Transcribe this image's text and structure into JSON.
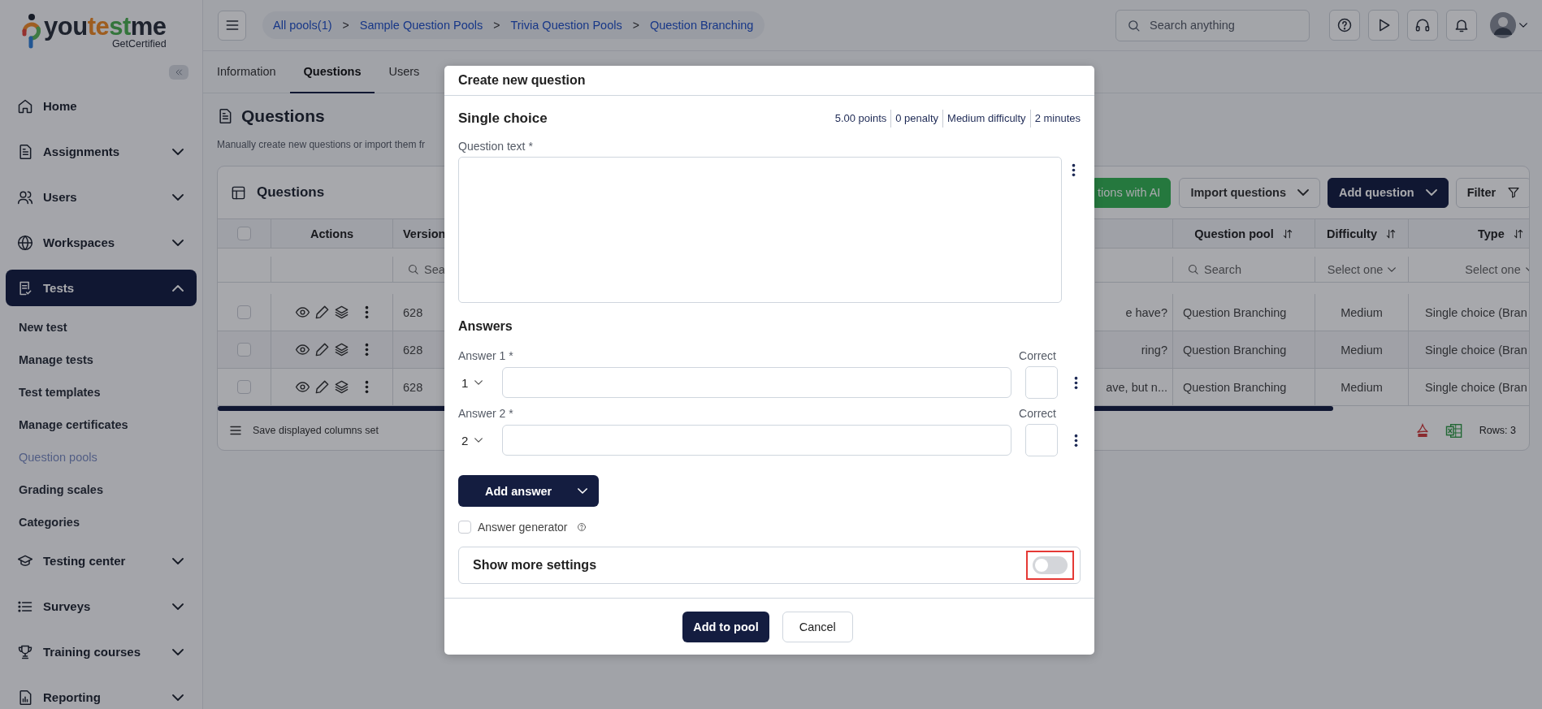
{
  "sidebar": {
    "logo": {
      "segments": [
        "you",
        "te",
        "st",
        "me"
      ],
      "tagline": "GetCertified"
    },
    "items": [
      {
        "label": "Home",
        "kind": "link",
        "selected": false
      },
      {
        "label": "Assignments",
        "kind": "group",
        "expanded": false,
        "selected": false
      },
      {
        "label": "Users",
        "kind": "group",
        "expanded": false,
        "selected": false
      },
      {
        "label": "Workspaces",
        "kind": "group",
        "expanded": false,
        "selected": false
      },
      {
        "label": "Tests",
        "kind": "group",
        "expanded": true,
        "selected": true,
        "children": [
          {
            "label": "New test",
            "selected": false
          },
          {
            "label": "Manage tests",
            "selected": false
          },
          {
            "label": "Test templates",
            "selected": false
          },
          {
            "label": "Manage certificates",
            "selected": false
          },
          {
            "label": "Question pools",
            "selected": true
          },
          {
            "label": "Grading scales",
            "selected": false
          },
          {
            "label": "Categories",
            "selected": false
          }
        ]
      },
      {
        "label": "Testing center",
        "kind": "group",
        "expanded": false,
        "selected": false
      },
      {
        "label": "Surveys",
        "kind": "group",
        "expanded": false,
        "selected": false
      },
      {
        "label": "Training courses",
        "kind": "group",
        "expanded": false,
        "selected": false
      },
      {
        "label": "Reporting",
        "kind": "group",
        "expanded": false,
        "selected": false
      }
    ]
  },
  "breadcrumbs": [
    {
      "label": "All pools(1)"
    },
    {
      "separator": ">",
      "label": "Sample Question Pools"
    },
    {
      "separator": ">",
      "label": "Trivia Question Pools"
    },
    {
      "separator": ">",
      "label": "Question Branching"
    }
  ],
  "search": {
    "placeholder": "Search anything"
  },
  "tabs": [
    {
      "label": "Information",
      "selected": false
    },
    {
      "label": "Questions",
      "selected": true
    },
    {
      "label": "Users",
      "selected": false
    }
  ],
  "page": {
    "title": "Questions",
    "description": "Manually create new questions or import them fr"
  },
  "table": {
    "title": "Questions",
    "buttons": [
      {
        "label": "tions with AI",
        "kind": "ai"
      },
      {
        "label": "Import questions",
        "kind": "outline"
      },
      {
        "label": "Add question",
        "kind": "primary"
      },
      {
        "label": "Filter",
        "kind": "filter"
      }
    ],
    "all_selected": false,
    "columns": [
      {
        "label": "Actions",
        "sortable": false
      },
      {
        "label": "Version",
        "sortable": false,
        "filter": {
          "kind": "search",
          "placeholder": "Sea"
        }
      },
      {
        "label": "Question pool",
        "sortable": true,
        "filter": {
          "kind": "search",
          "placeholder": "Search"
        }
      },
      {
        "label": "Difficulty",
        "sortable": true,
        "filter": {
          "kind": "select",
          "placeholder": "Select one"
        }
      },
      {
        "label": "Type",
        "sortable": true,
        "filter": {
          "kind": "select",
          "placeholder": "Select one"
        }
      }
    ],
    "rows": [
      {
        "selected": false,
        "cells": [
          "",
          "628",
          "Question Branching",
          "Medium",
          "Single choice (Bran"
        ],
        "column_4": "e have?"
      },
      {
        "selected": false,
        "cells": [
          "",
          "628",
          "Question Branching",
          "Medium",
          "Single choice (Bran"
        ],
        "column_4": "ring?"
      },
      {
        "selected": false,
        "cells": [
          "",
          "628",
          "Question Branching",
          "Medium",
          "Single choice (Bran"
        ],
        "column_4": "ave, but n..."
      }
    ],
    "save_columns": "Save displayed columns set",
    "rows_count": "Rows: 3"
  },
  "dialog": {
    "title": "Create new question",
    "question_type": "Single choice",
    "meta": [
      "5.00 points",
      "0 penalty",
      "Medium difficulty",
      "2 minutes"
    ],
    "question_label": "Question text *",
    "answers_heading": "Answers",
    "answers": [
      {
        "label": "Answer 1 *",
        "number": "1",
        "correct_label": "Correct",
        "correct": false
      },
      {
        "label": "Answer 2 *",
        "number": "2",
        "correct_label": "Correct",
        "correct": false
      }
    ],
    "add_answer": "Add answer",
    "answer_generator": {
      "label": "Answer generator",
      "checked": false
    },
    "more_settings": {
      "label": "Show more settings",
      "on": false,
      "highlighted": true
    },
    "buttons": [
      {
        "label": "Add to pool",
        "kind": "primary"
      },
      {
        "label": "Cancel",
        "kind": "secondary"
      }
    ]
  }
}
